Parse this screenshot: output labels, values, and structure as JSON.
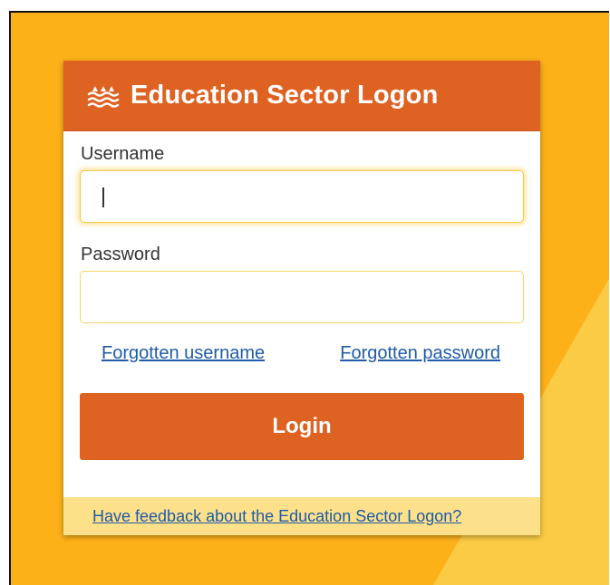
{
  "colors": {
    "background": "#FDB119",
    "background_accent": "#FCC53A",
    "header": "#DE6222",
    "button": "#DE6222",
    "link": "#1f5ba8",
    "footer": "#FDE08A"
  },
  "header": {
    "logo_icon": "waves-icon",
    "title": "Education Sector Logon"
  },
  "form": {
    "username_label": "Username",
    "username_value": "",
    "password_label": "Password",
    "password_value": ""
  },
  "links": {
    "forgot_username": "Forgotten username",
    "forgot_password": "Forgotten password"
  },
  "login_button": "Login",
  "footer": {
    "feedback_link": "Have feedback about the Education Sector Logon?"
  }
}
